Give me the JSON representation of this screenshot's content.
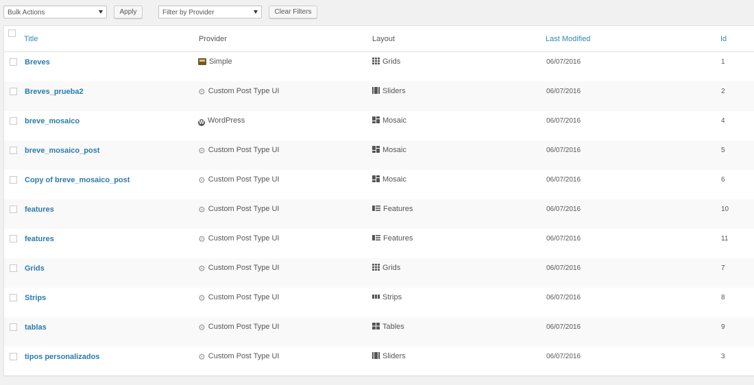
{
  "toolbar": {
    "bulk_actions": "Bulk Actions",
    "apply": "Apply",
    "filter_provider": "Filter by Provider",
    "clear_filters": "Clear Filters"
  },
  "columns": {
    "title": "Title",
    "provider": "Provider",
    "layout": "Layout",
    "last_modified": "Last Modified",
    "id": "Id"
  },
  "rows": [
    {
      "title": "Breves",
      "provider": "Simple",
      "provider_icon": "simple-icon",
      "layout": "Grids",
      "layout_icon": "grids-icon",
      "modified": "06/07/2016",
      "id": "1"
    },
    {
      "title": "Breves_prueba2",
      "provider": "Custom Post Type UI",
      "provider_icon": "gear-icon",
      "layout": "Sliders",
      "layout_icon": "sliders-icon",
      "modified": "06/07/2016",
      "id": "2"
    },
    {
      "title": "breve_mosaico",
      "provider": "WordPress",
      "provider_icon": "wordpress-icon",
      "layout": "Mosaic",
      "layout_icon": "mosaic-icon",
      "modified": "06/07/2016",
      "id": "4"
    },
    {
      "title": "breve_mosaico_post",
      "provider": "Custom Post Type UI",
      "provider_icon": "gear-icon",
      "layout": "Mosaic",
      "layout_icon": "mosaic-icon",
      "modified": "06/07/2016",
      "id": "5"
    },
    {
      "title": "Copy of breve_mosaico_post",
      "provider": "Custom Post Type UI",
      "provider_icon": "gear-icon",
      "layout": "Mosaic",
      "layout_icon": "mosaic-icon",
      "modified": "06/07/2016",
      "id": "6"
    },
    {
      "title": "features",
      "provider": "Custom Post Type UI",
      "provider_icon": "gear-icon",
      "layout": "Features",
      "layout_icon": "features-icon",
      "modified": "06/07/2016",
      "id": "10"
    },
    {
      "title": "features",
      "provider": "Custom Post Type UI",
      "provider_icon": "gear-icon",
      "layout": "Features",
      "layout_icon": "features-icon",
      "modified": "06/07/2016",
      "id": "11"
    },
    {
      "title": "Grids",
      "provider": "Custom Post Type UI",
      "provider_icon": "gear-icon",
      "layout": "Grids",
      "layout_icon": "grids-icon",
      "modified": "06/07/2016",
      "id": "7"
    },
    {
      "title": "Strips",
      "provider": "Custom Post Type UI",
      "provider_icon": "gear-icon",
      "layout": "Strips",
      "layout_icon": "strips-icon",
      "modified": "06/07/2016",
      "id": "8"
    },
    {
      "title": "tablas",
      "provider": "Custom Post Type UI",
      "provider_icon": "gear-icon",
      "layout": "Tables",
      "layout_icon": "tables-icon",
      "modified": "06/07/2016",
      "id": "9"
    },
    {
      "title": "tipos personalizados",
      "provider": "Custom Post Type UI",
      "provider_icon": "gear-icon",
      "layout": "Sliders",
      "layout_icon": "sliders-icon",
      "modified": "06/07/2016",
      "id": "3"
    }
  ]
}
